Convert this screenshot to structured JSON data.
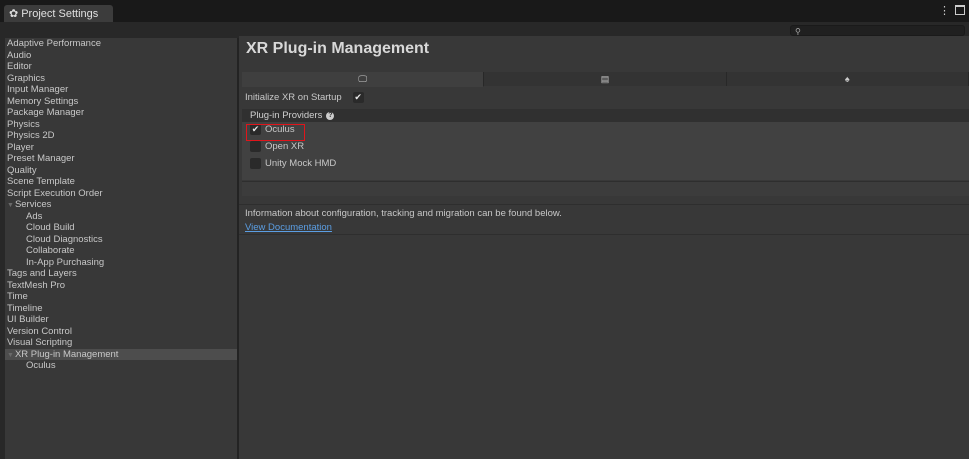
{
  "window": {
    "tab_title": "Project Settings",
    "menu_icon": "kebab-menu-icon",
    "maximize_icon": "maximize-icon"
  },
  "search": {
    "placeholder": "",
    "icon": "search-icon"
  },
  "sidebar": {
    "items": [
      {
        "label": "Adaptive Performance",
        "level": 0
      },
      {
        "label": "Audio",
        "level": 0
      },
      {
        "label": "Editor",
        "level": 0
      },
      {
        "label": "Graphics",
        "level": 0
      },
      {
        "label": "Input Manager",
        "level": 0
      },
      {
        "label": "Memory Settings",
        "level": 0
      },
      {
        "label": "Package Manager",
        "level": 0
      },
      {
        "label": "Physics",
        "level": 0
      },
      {
        "label": "Physics 2D",
        "level": 0
      },
      {
        "label": "Player",
        "level": 0
      },
      {
        "label": "Preset Manager",
        "level": 0
      },
      {
        "label": "Quality",
        "level": 0
      },
      {
        "label": "Scene Template",
        "level": 0
      },
      {
        "label": "Script Execution Order",
        "level": 0
      },
      {
        "label": "Services",
        "level": 0,
        "expanded": true
      },
      {
        "label": "Ads",
        "level": 1
      },
      {
        "label": "Cloud Build",
        "level": 1
      },
      {
        "label": "Cloud Diagnostics",
        "level": 1
      },
      {
        "label": "Collaborate",
        "level": 1
      },
      {
        "label": "In-App Purchasing",
        "level": 1
      },
      {
        "label": "Tags and Layers",
        "level": 0
      },
      {
        "label": "TextMesh Pro",
        "level": 0
      },
      {
        "label": "Time",
        "level": 0
      },
      {
        "label": "Timeline",
        "level": 0
      },
      {
        "label": "UI Builder",
        "level": 0
      },
      {
        "label": "Version Control",
        "level": 0
      },
      {
        "label": "Visual Scripting",
        "level": 0
      },
      {
        "label": "XR Plug-in Management",
        "level": 0,
        "expanded": true,
        "selected": true
      },
      {
        "label": "Oculus",
        "level": 1
      }
    ]
  },
  "main": {
    "title": "XR Plug-in Management",
    "platform_tabs": [
      {
        "icon": "monitor-icon",
        "glyph": "🖵",
        "active": true
      },
      {
        "icon": "server-icon",
        "glyph": "▤",
        "active": false
      },
      {
        "icon": "android-icon",
        "glyph": "♠",
        "active": false
      }
    ],
    "init_label": "Initialize XR on Startup",
    "init_checked": true,
    "providers_header": "Plug-in Providers",
    "help_icon": "help-icon",
    "providers": [
      {
        "label": "Oculus",
        "checked": true
      },
      {
        "label": "Open XR",
        "checked": false
      },
      {
        "label": "Unity Mock HMD",
        "checked": false
      }
    ],
    "info_text": "Information about configuration, tracking and migration can be found below.",
    "doc_link": "View Documentation"
  },
  "colors": {
    "highlight": "#e0151b",
    "link": "#5b9ee3",
    "background": "#383838"
  }
}
